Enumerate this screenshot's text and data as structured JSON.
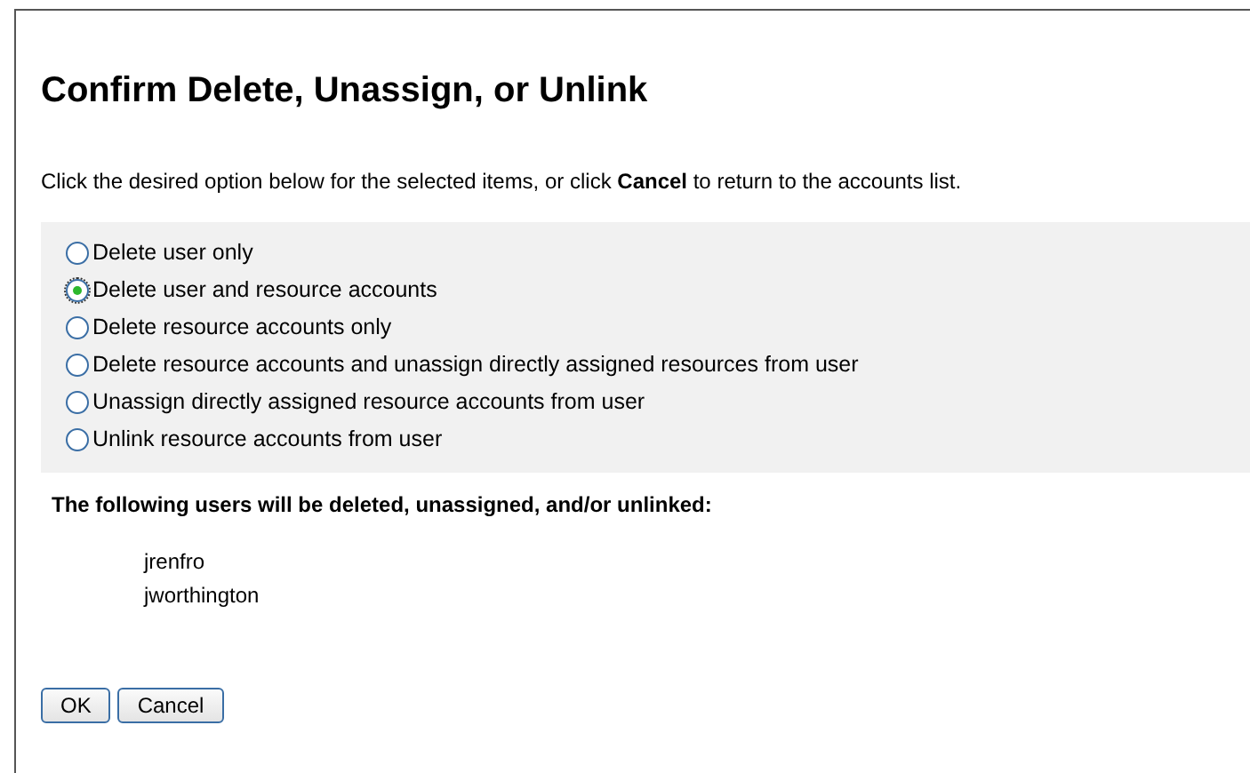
{
  "title": "Confirm Delete, Unassign, or Unlink",
  "instruction": "Click the desired option below for the selected items, or click **Cancel** to return to the accounts list.",
  "options": [
    {
      "label": "Delete user only",
      "selected": false
    },
    {
      "label": "Delete user and resource accounts",
      "selected": true
    },
    {
      "label": "Delete resource accounts only",
      "selected": false
    },
    {
      "label": "Delete resource accounts and unassign directly assigned resources from user",
      "selected": false
    },
    {
      "label": "Unassign directly assigned resource accounts from user",
      "selected": false
    },
    {
      "label": "Unlink resource accounts from user",
      "selected": false
    }
  ],
  "users_heading": "The following users will be deleted, unassigned, and/or unlinked:",
  "users": [
    "jrenfro",
    "jworthington"
  ],
  "buttons": [
    "OK",
    "Cancel"
  ]
}
